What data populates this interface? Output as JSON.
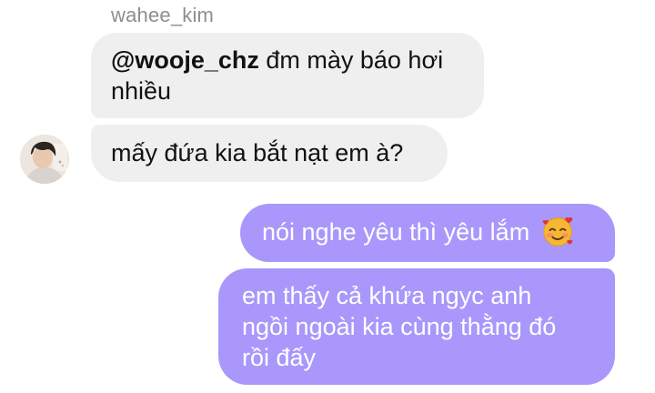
{
  "conversation": {
    "incoming": {
      "sender_name": "wahee_kim",
      "message1": {
        "mention": "@wooje_chz",
        "text_line1": " đm mày báo hơi",
        "text_line2": "nhiều"
      },
      "message2": {
        "text": "mấy đứa kia bắt nạt em à?"
      }
    },
    "outgoing": {
      "message3": {
        "text": "nói nghe yêu thì yêu lắm",
        "emoji": "smiling-face-with-hearts-icon"
      },
      "message4": {
        "line1": "em thấy cả khứa ngyc anh",
        "line2": "ngồi ngoài kia cùng thằng đó",
        "line3": "rồi đấy"
      }
    }
  },
  "colors": {
    "incoming_bubble": "#efefef",
    "outgoing_bubble": "#a997fb",
    "sender_name": "#8e8e8e"
  }
}
